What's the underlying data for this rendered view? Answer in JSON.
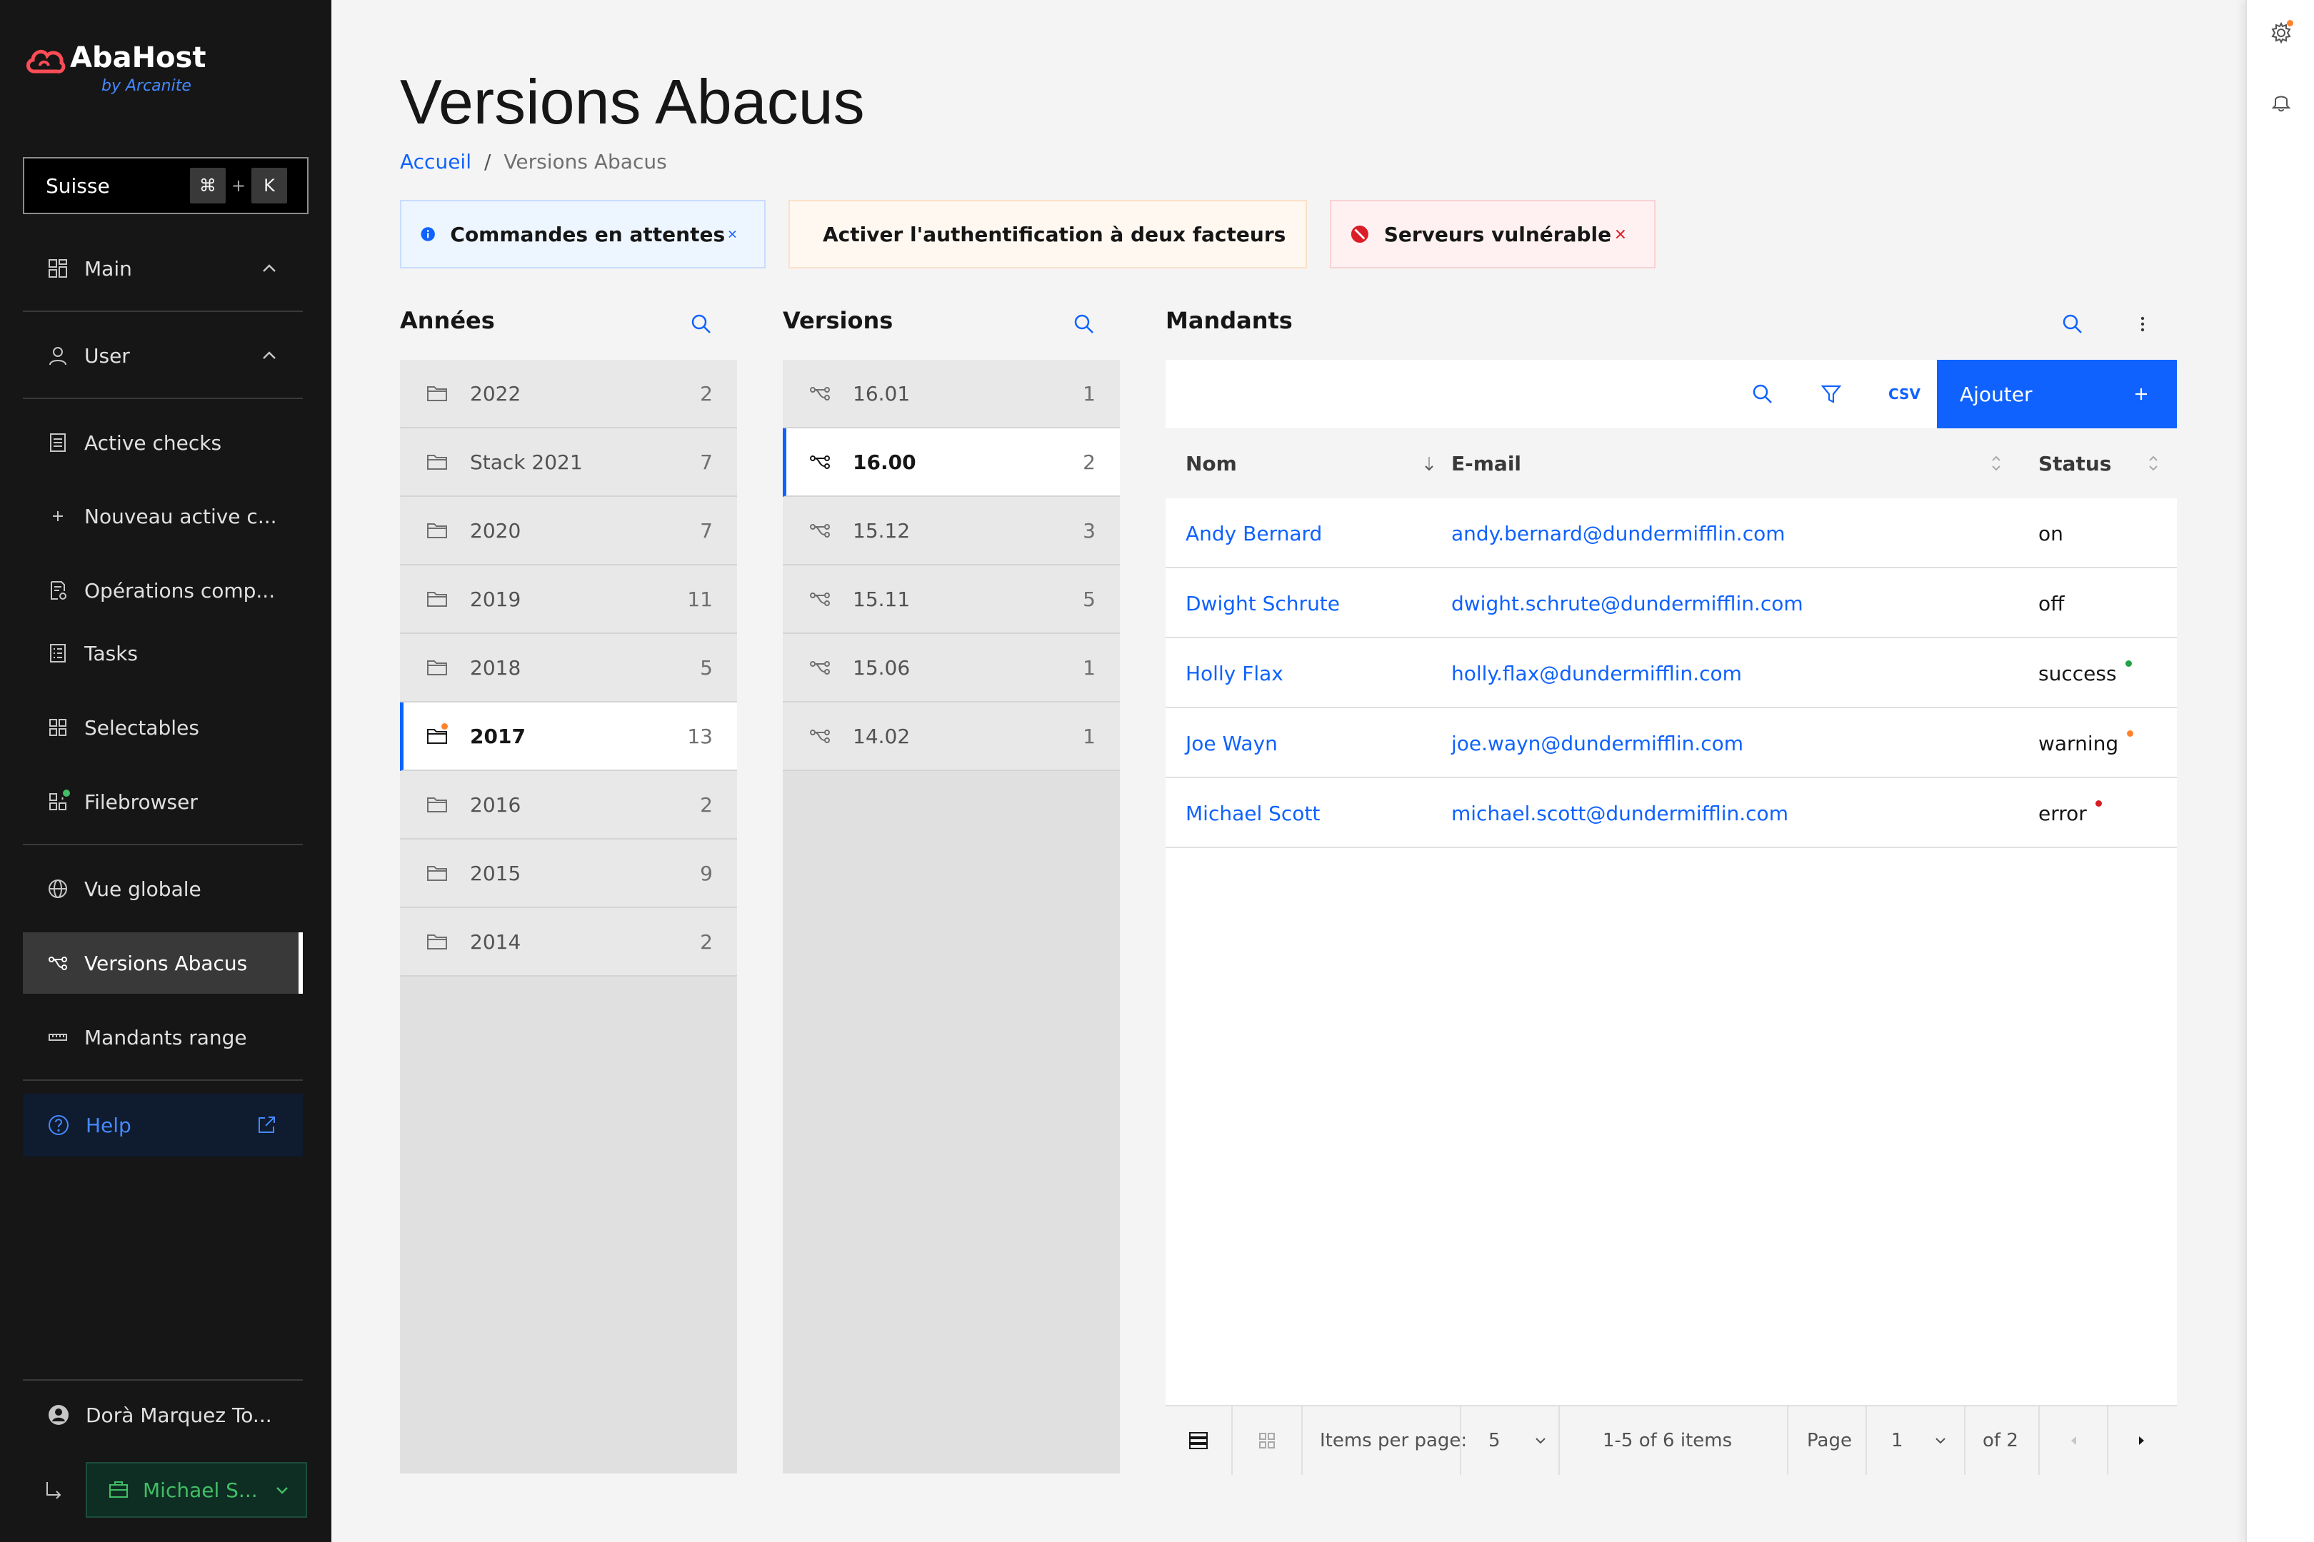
{
  "brand": {
    "name": "AbaHost",
    "by": "by Arcanite"
  },
  "search": {
    "label": "Suisse",
    "key1": "⌘",
    "plus": "+",
    "key2": "K"
  },
  "nav": {
    "main": "Main",
    "user": "User",
    "active_checks": "Active checks",
    "nouveau": "Nouveau active c...",
    "operations": "Opérations comp...",
    "tasks": "Tasks",
    "selectables": "Selectables",
    "filebrowser": "Filebrowser",
    "vue_globale": "Vue globale",
    "versions": "Versions Abacus",
    "mandants_range": "Mandants range",
    "help": "Help"
  },
  "user": {
    "name": "Dorà Marquez To...",
    "client": "Michael S..."
  },
  "page": {
    "title": "Versions Abacus"
  },
  "breadcrumb": {
    "home": "Accueil",
    "sep": "/",
    "current": "Versions Abacus"
  },
  "notifications": {
    "info": "Commandes en attentes",
    "warning": "Activer l'authentification à deux facteurs",
    "error": "Serveurs vulnérable"
  },
  "years": {
    "title": "Années",
    "items": [
      {
        "label": "2022",
        "count": "2"
      },
      {
        "label": "Stack 2021",
        "count": "7"
      },
      {
        "label": "2020",
        "count": "7"
      },
      {
        "label": "2019",
        "count": "11"
      },
      {
        "label": "2018",
        "count": "5"
      },
      {
        "label": "2017",
        "count": "13"
      },
      {
        "label": "2016",
        "count": "2"
      },
      {
        "label": "2015",
        "count": "9"
      },
      {
        "label": "2014",
        "count": "2"
      }
    ]
  },
  "versions": {
    "title": "Versions",
    "items": [
      {
        "label": "16.01",
        "count": "1"
      },
      {
        "label": "16.00",
        "count": "2"
      },
      {
        "label": "15.12",
        "count": "3"
      },
      {
        "label": "15.11",
        "count": "5"
      },
      {
        "label": "15.06",
        "count": "1"
      },
      {
        "label": "14.02",
        "count": "1"
      }
    ]
  },
  "mandants": {
    "title": "Mandants",
    "csv": "CSV",
    "add": "Ajouter",
    "columns": {
      "name": "Nom",
      "email": "E-mail",
      "status": "Status"
    },
    "rows": [
      {
        "name": "Andy Bernard",
        "email": "andy.bernard@dundermifflin.com",
        "status": "on"
      },
      {
        "name": "Dwight Schrute",
        "email": "dwight.schrute@dundermifflin.com",
        "status": "off"
      },
      {
        "name": "Holly Flax",
        "email": "holly.flax@dundermifflin.com",
        "status": "success"
      },
      {
        "name": "Joe Wayn",
        "email": "joe.wayn@dundermifflin.com",
        "status": "warning"
      },
      {
        "name": "Michael Scott",
        "email": "michael.scott@dundermifflin.com",
        "status": "error"
      }
    ],
    "pagination": {
      "items_per_page_label": "Items per page:",
      "items_per_page": "5",
      "range": "1-5 of 6 items",
      "page_label": "Page",
      "page": "1",
      "of": "of 2"
    }
  },
  "colors": {
    "accent": "#0f62fe",
    "success": "#24a148",
    "warning": "#ff832b",
    "error": "#da1e28"
  }
}
